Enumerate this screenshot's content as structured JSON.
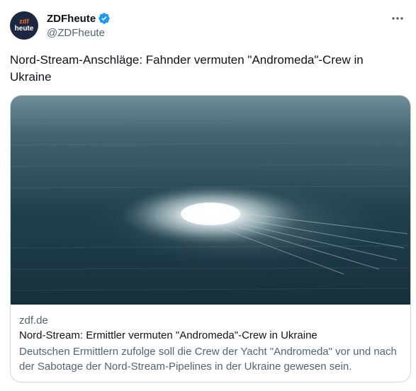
{
  "account": {
    "display_name": "ZDFheute",
    "handle": "@ZDFheute",
    "avatar_top": "zdf",
    "avatar_bottom": "heute",
    "verified": true
  },
  "tweet": {
    "text": "Nord-Stream-Anschläge: Fahnder vermuten \"Andromeda\"-Crew in Ukraine"
  },
  "card": {
    "image_description": "aerial photo of gas bubbling on sea surface",
    "domain": "zdf.de",
    "title": "Nord-Stream: Ermittler vermuten \"Andromeda\"-Crew in Ukraine",
    "description": "Deutschen Ermittlern zufolge soll die Crew der Yacht \"Andromeda\" vor und nach der Sabotage der Nord-Stream-Pipelines in der Ukraine gewesen sein."
  },
  "colors": {
    "verified_badge": "#1d9bf0",
    "secondary_text": "#536471",
    "avatar_bg": "#1c2742",
    "avatar_accent": "#ff6d25"
  },
  "icons": {
    "more": "more-horizontal-icon",
    "verified": "verified-badge-icon"
  }
}
